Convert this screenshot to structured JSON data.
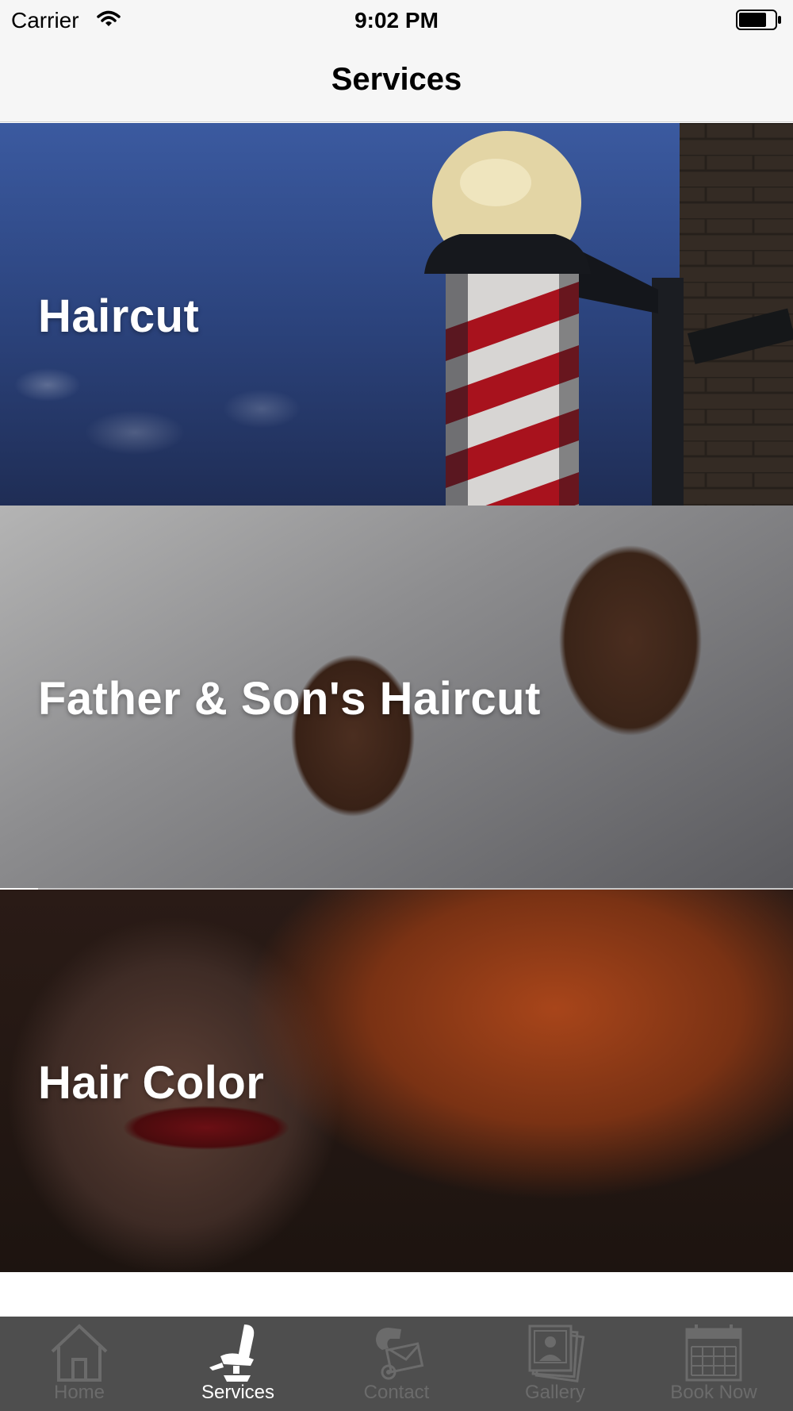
{
  "status_bar": {
    "carrier": "Carrier",
    "time": "9:02 PM"
  },
  "nav": {
    "title": "Services"
  },
  "services": [
    {
      "label": "Haircut"
    },
    {
      "label": "Father & Son's Haircut"
    },
    {
      "label": "Hair Color"
    }
  ],
  "tab_bar": {
    "active_index": 1,
    "active_color": "#ffffff",
    "inactive_color": "#6b6b6b",
    "background": "#4e4e4e",
    "tabs": [
      {
        "label": "Home",
        "icon": "home-icon"
      },
      {
        "label": "Services",
        "icon": "barber-chair-icon"
      },
      {
        "label": "Contact",
        "icon": "phone-mail-icon"
      },
      {
        "label": "Gallery",
        "icon": "gallery-icon"
      },
      {
        "label": "Book Now",
        "icon": "calendar-icon"
      }
    ]
  }
}
